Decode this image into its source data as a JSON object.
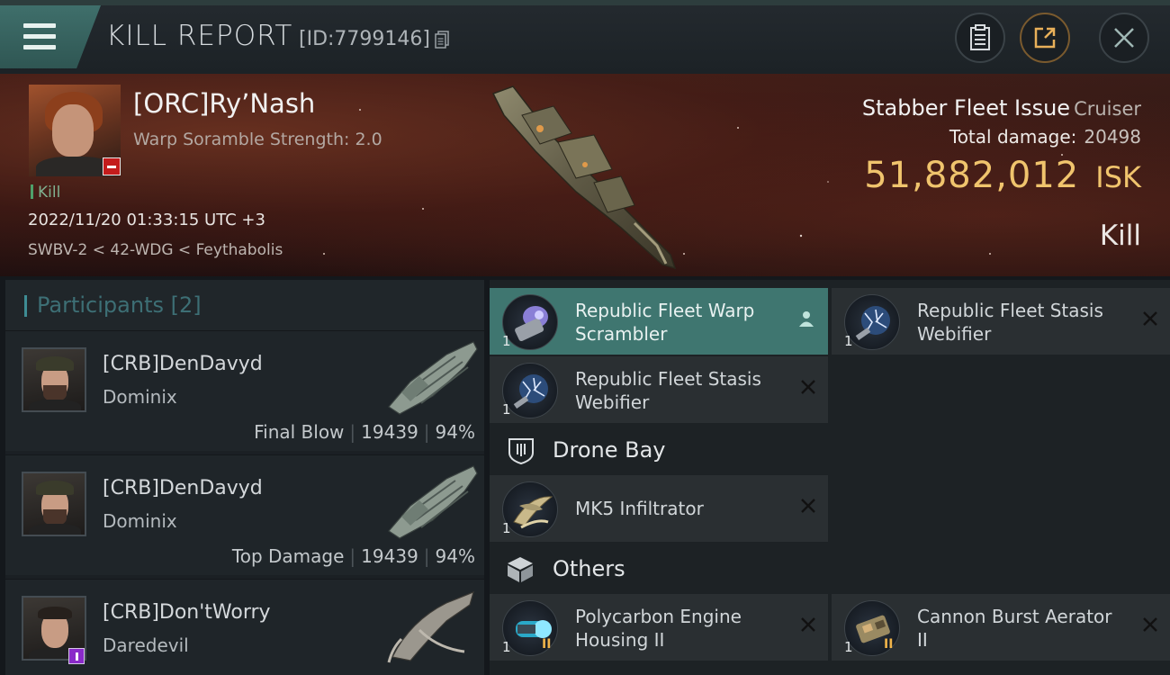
{
  "titlebar": {
    "title": "KILL REPORT",
    "report_id": "[ID:7799146]",
    "icons": [
      "menu-icon",
      "copy-icon",
      "clipboard-icon",
      "share-icon",
      "close-icon"
    ]
  },
  "victim": {
    "name": "[ORC]Ry’Nash",
    "scramble_text": "Warp Soramble Strength: 2.0",
    "tag": "Kill",
    "datetime": "2022/11/20 01:33:15 UTC +3",
    "location": "SWBV-2 < 42-WDG < Feythabolis"
  },
  "ship": {
    "name": "Stabber Fleet Issue",
    "class": "Cruiser",
    "damage_label": "Total damage:",
    "damage_value": "20498",
    "isk_value": "51,882,012",
    "isk_unit": "ISK",
    "result": "Kill"
  },
  "participants": {
    "label": "Participants [2]",
    "items": [
      {
        "name": "[CRB]DenDavyd",
        "ship": "Dominix",
        "role": "Final Blow",
        "damage": "19439",
        "percent": "94%"
      },
      {
        "name": "[CRB]DenDavyd",
        "ship": "Dominix",
        "role": "Top Damage",
        "damage": "19439",
        "percent": "94%"
      },
      {
        "name": "[CRB]Don'tWorry",
        "ship": "Daredevil"
      }
    ]
  },
  "modules": {
    "slot1": {
      "name": "Republic Fleet Warp Scrambler",
      "qty": "1"
    },
    "slot2": {
      "name": "Republic Fleet Stasis Webifier",
      "qty": "1"
    },
    "slot3": {
      "name": "Republic Fleet Stasis Webifier",
      "qty": "1"
    },
    "drone_bay": {
      "label": "Drone Bay"
    },
    "drone1": {
      "name": "MK5 Infiltrator",
      "qty": "1"
    },
    "others": {
      "label": "Others"
    },
    "other1": {
      "name": "Polycarbon Engine Housing II",
      "qty": "1",
      "meta": "II"
    },
    "other2": {
      "name": "Cannon Burst Aerator II",
      "qty": "1",
      "meta": "II"
    }
  },
  "colors": {
    "accent": "#3f7670",
    "isk": "#f0c46d",
    "header_bg": "#3a1d18"
  }
}
